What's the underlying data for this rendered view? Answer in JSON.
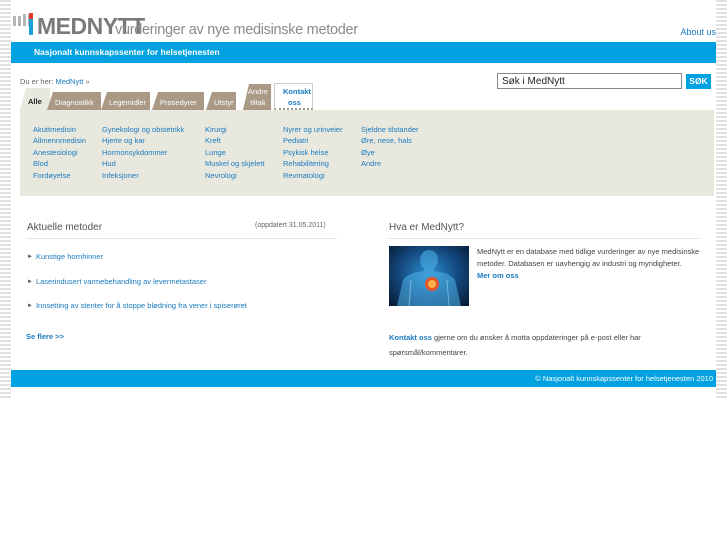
{
  "header": {
    "logo_text": "MEDNYTT",
    "tagline": "vurderinger av nye medisinske metoder",
    "about_link": "About us",
    "subtitle": "Nasjonalt kunnskapssenter for helsetjenesten"
  },
  "breadcrumb": {
    "prefix": "Du er her:",
    "current": "MedNytt",
    "separator": "»"
  },
  "search": {
    "value": "Søk i MedNytt",
    "button_label": "SØK"
  },
  "tabs": [
    {
      "label": "Alle"
    },
    {
      "label": "Diagnostikk"
    },
    {
      "label": "Legemidler"
    },
    {
      "label": "Prosedyrer"
    },
    {
      "label": "Utstyr"
    },
    {
      "label": "Andre tiltak"
    },
    {
      "label": "Kontakt oss"
    }
  ],
  "categories": {
    "col1": [
      "Akuttmedisin",
      "Allmennmedisin",
      "Anestesiologi",
      "Blod",
      "Fordøyelse"
    ],
    "col2": [
      "Gynekologi og obstetrikk",
      "Hjerte og kar",
      "Hormonsykdommer",
      "Hud",
      "Infeksjoner"
    ],
    "col3": [
      "Kirurgi",
      "Kreft",
      "Lunge",
      "Muskel og skjelett",
      "Nevrologi"
    ],
    "col4": [
      "Nyrer og urinveier",
      "Pediatri",
      "Psykisk helse",
      "Rehabilitering",
      "Revmatologi"
    ],
    "col5": [
      "Sjeldne tilstander",
      "Øre, nese, hals",
      "Øye",
      "Andre"
    ]
  },
  "current_methods": {
    "title": "Aktuelle metoder",
    "updated": "(oppdatert 31.05.2011)",
    "items": [
      "Kunstige hornhinner",
      "Laserindusert varmebehandling av levermetastaser",
      "Innsetting av stenter for å stoppe blødning fra vener i spiserøret"
    ],
    "see_more": "Se flere >>"
  },
  "about": {
    "title": "Hva er MedNytt?",
    "text": "MedNytt er en database med tidlige vurderinger av nye medisinske metoder. Databasen er uavhengig av industri og myndigheter.",
    "more_link": "Mer om oss",
    "contact_link": "Kontakt oss",
    "contact_text": " gjerne om du ønsker å motta oppdateringer på e-post eller har spørsmål/kommentarer."
  },
  "footer": {
    "copyright": "© Nasjonalt kunnskapssenter for helsetjenesten 2010"
  },
  "colors": {
    "brand_blue": "#00a1e0",
    "link_blue": "#1a7bbf",
    "tab_brown": "#a99985",
    "panel_beige": "#e9e8df"
  }
}
